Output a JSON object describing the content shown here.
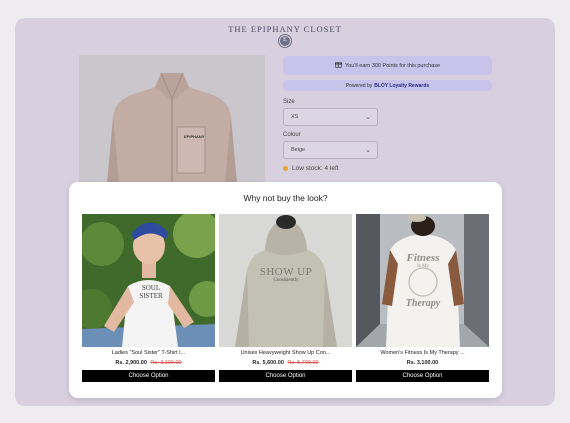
{
  "store": {
    "brand": "THE EPIPHANY CLOSET",
    "badge": "E"
  },
  "loyalty": {
    "earn_text": "You'll earn 300 Points for this purchase",
    "powered_prefix": "Powered by",
    "powered_brand": "BLOY Loyalty Rewards"
  },
  "product": {
    "jacket_label": "EPIPHANY",
    "size_label": "Size",
    "size_value": "XS",
    "colour_label": "Colour",
    "colour_value": "Beige",
    "stock_text": "Low stock: 4 left"
  },
  "modal": {
    "title": "Why not buy the look?",
    "items": [
      {
        "name": "Ladies \"Soul Sister\" T-Shirt I...",
        "price": "Rs. 2,900.00",
        "old_price": "Rs. 3,100.00",
        "button": "Choose Option",
        "print": [
          "SOUL",
          "SISTER"
        ]
      },
      {
        "name": "Unisex Heavyweight Show Up Con...",
        "price": "Rs. 5,600.00",
        "old_price": "Rs. 5,700.00",
        "button": "Choose Option",
        "print": [
          "SHOW UP",
          "Consistently"
        ]
      },
      {
        "name": "Women's Fitness Is My Therapy ...",
        "price": "Rs. 3,100.00",
        "button": "Choose Option",
        "print": [
          "Fitness",
          "Is",
          "My",
          "Therapy"
        ]
      }
    ]
  },
  "colors": {
    "frame": "#d8d0df",
    "loyalty_box": "#c7c3eb",
    "button": "#000000",
    "old_price": "#d9534f",
    "stock_dot": "#e8a33a"
  },
  "icons": [
    "gift-icon",
    "chevron-down-icon",
    "stock-dot-icon"
  ]
}
